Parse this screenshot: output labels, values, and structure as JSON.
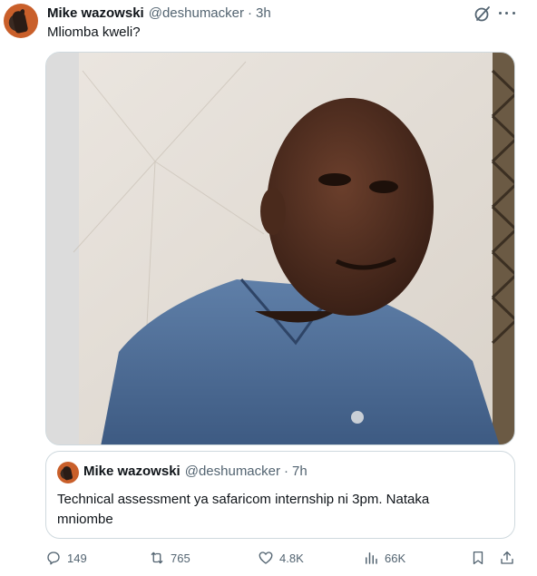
{
  "tweet": {
    "author_name": "Mike wazowski",
    "author_handle": "@deshumacker",
    "separator": "·",
    "time": "3h",
    "text": "Mliomba kweli?",
    "icons": {
      "grok": "grok-slash-icon",
      "more": "more-icon"
    },
    "photo_alt": "man in denim shirt"
  },
  "quoted_tweet": {
    "author_name": "Mike wazowski",
    "author_handle": "@deshumacker",
    "separator": "·",
    "time": "7h",
    "text": "Technical assessment ya safaricom internship ni 3pm. Nataka mniombe"
  },
  "actions": {
    "replies": "149",
    "retweets": "765",
    "likes": "4.8K",
    "views": "66K",
    "icons": [
      "reply-icon",
      "retweet-icon",
      "like-icon",
      "views-icon",
      "bookmark-icon",
      "share-icon"
    ]
  },
  "colors": {
    "text": "#0f1419",
    "secondary": "#536471",
    "border": "#cfd9de",
    "background": "#ffffff"
  }
}
